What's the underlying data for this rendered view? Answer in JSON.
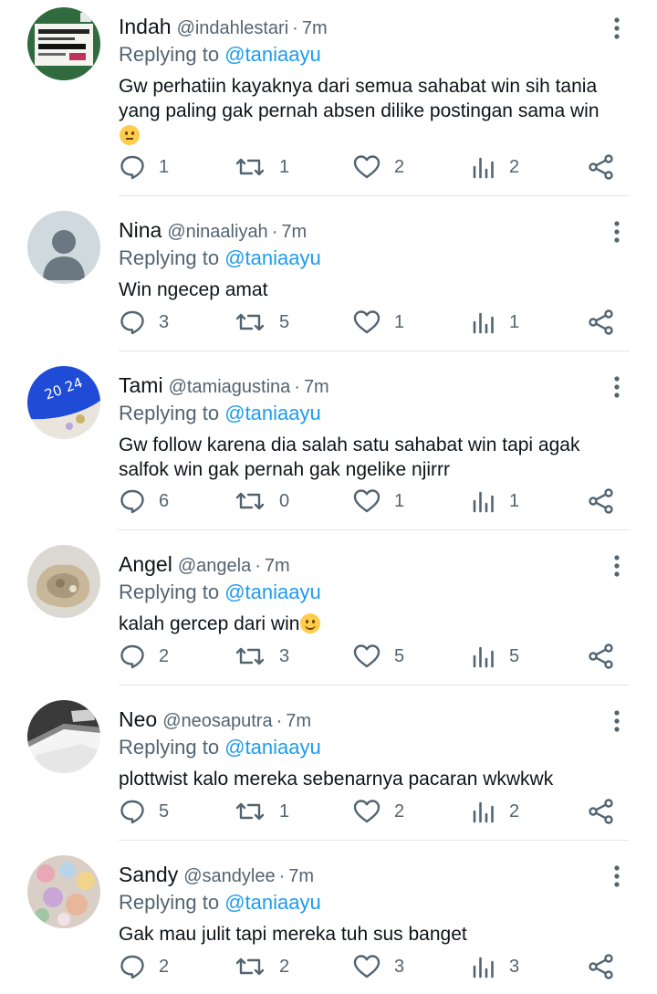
{
  "replying_label": "Replying to",
  "replies": [
    {
      "name": "Indah",
      "handle": "@indahlestari",
      "dot": "·",
      "time": "7m",
      "replying_to": "@taniaayu",
      "text": "Gw perhatiin kayaknya dari semua sahabat win sih tania yang paling gak pernah absen dilike postingan sama win",
      "emoji": "thinking-face",
      "stats": {
        "replies": "1",
        "retweets": "1",
        "likes": "2",
        "views": "2"
      }
    },
    {
      "name": "Nina",
      "handle": "@ninaaliyah",
      "dot": "·",
      "time": "7m",
      "replying_to": "@taniaayu",
      "text": "Win ngecep amat",
      "stats": {
        "replies": "3",
        "retweets": "5",
        "likes": "1",
        "views": "1"
      }
    },
    {
      "name": "Tami",
      "handle": "@tamiagustina",
      "dot": "·",
      "time": "7m",
      "replying_to": "@taniaayu",
      "text": "Gw follow karena dia salah satu sahabat win tapi agak salfok win gak pernah gak ngelike njirrr",
      "stats": {
        "replies": "6",
        "retweets": "0",
        "likes": "1",
        "views": "1"
      }
    },
    {
      "name": "Angel",
      "handle": "@angela",
      "dot": "·",
      "time": "7m",
      "replying_to": "@taniaayu",
      "text": "kalah gercep dari win",
      "emoji": "slightly-smiling-face",
      "stats": {
        "replies": "2",
        "retweets": "3",
        "likes": "5",
        "views": "5"
      }
    },
    {
      "name": "Neo",
      "handle": "@neosaputra",
      "dot": "·",
      "time": "7m",
      "replying_to": "@taniaayu",
      "text": "plottwist kalo mereka sebenarnya pacaran wkwkwk",
      "stats": {
        "replies": "5",
        "retweets": "1",
        "likes": "2",
        "views": "2"
      }
    },
    {
      "name": "Sandy",
      "handle": "@sandylee",
      "dot": "·",
      "time": "7m",
      "replying_to": "@taniaayu",
      "text": "Gak mau julit tapi mereka tuh sus banget",
      "stats": {
        "replies": "2",
        "retweets": "2",
        "likes": "3",
        "views": "3"
      }
    }
  ],
  "colors": {
    "text": "#0f1419",
    "secondary": "#536471",
    "link": "#1d9bf0",
    "divider": "#e1e6ea"
  }
}
